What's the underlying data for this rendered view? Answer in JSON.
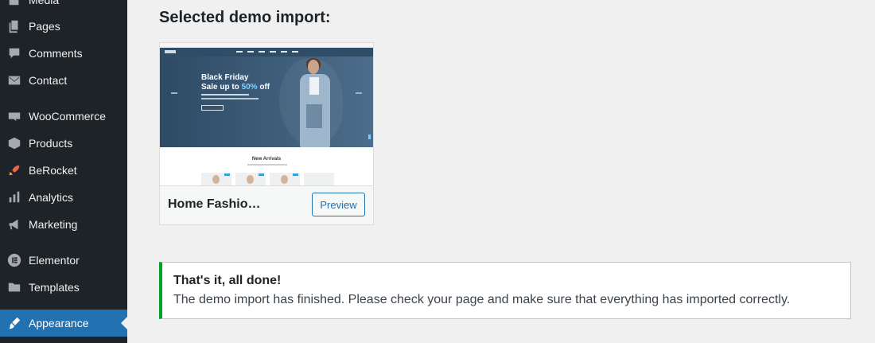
{
  "sidebar": {
    "items": [
      {
        "label": "Media",
        "icon": "media-icon"
      },
      {
        "label": "Pages",
        "icon": "pages-icon"
      },
      {
        "label": "Comments",
        "icon": "comments-icon"
      },
      {
        "label": "Contact",
        "icon": "envelope-icon"
      },
      {
        "label": "WooCommerce",
        "icon": "woocommerce-icon"
      },
      {
        "label": "Products",
        "icon": "products-box-icon"
      },
      {
        "label": "BeRocket",
        "icon": "rocket-icon"
      },
      {
        "label": "Analytics",
        "icon": "bar-chart-icon"
      },
      {
        "label": "Marketing",
        "icon": "megaphone-icon"
      },
      {
        "label": "Elementor",
        "icon": "elementor-icon"
      },
      {
        "label": "Templates",
        "icon": "folder-icon"
      },
      {
        "label": "Appearance",
        "icon": "paintbrush-icon",
        "active": true
      }
    ]
  },
  "main": {
    "heading": "Selected demo import:",
    "demo_card": {
      "title": "Home Fashio…",
      "preview_label": "Preview",
      "thumbnail": {
        "hero_line1": "Black Friday",
        "hero_line2_prefix": "Sale up to ",
        "hero_line2_percent": "50%",
        "hero_line2_suffix": " off",
        "section_title": "New Arrivals"
      }
    },
    "notice": {
      "title": "That's it, all done!",
      "text": "The demo import has finished. Please check your page and make sure that everything has imported correctly."
    }
  },
  "colors": {
    "sidebar_bg": "#1d2327",
    "active_bg": "#2271b1",
    "notice_border": "#00a32a",
    "page_bg": "#f0f0f1"
  }
}
